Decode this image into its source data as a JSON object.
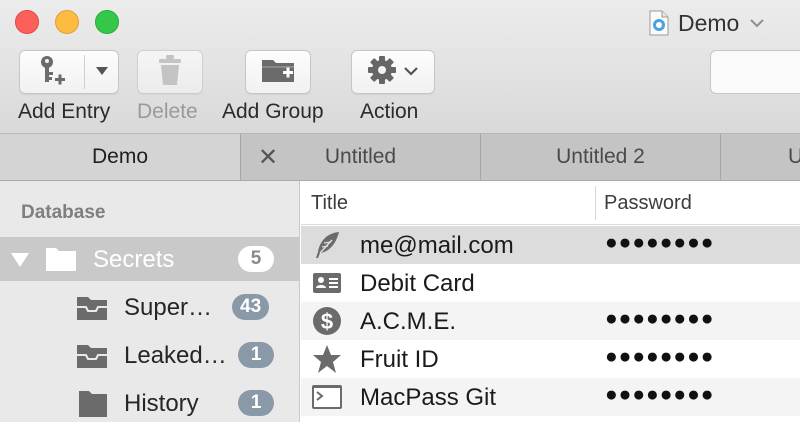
{
  "window": {
    "document_title": "Demo"
  },
  "toolbar": {
    "add_entry": "Add Entry",
    "delete": "Delete",
    "add_group": "Add Group",
    "action": "Action"
  },
  "tabs": [
    {
      "label": "Demo",
      "active": true
    },
    {
      "label": "Untitled",
      "active": false
    },
    {
      "label": "Untitled 2",
      "active": false
    },
    {
      "label": "U",
      "active": false
    }
  ],
  "sidebar": {
    "header": "Database",
    "items": [
      {
        "label": "Secrets",
        "count": "5",
        "selected": true,
        "icon": "folder-icon"
      },
      {
        "label": "Super…",
        "count": "43",
        "selected": false,
        "icon": "inbox-folder-icon"
      },
      {
        "label": "Leaked…",
        "count": "1",
        "selected": false,
        "icon": "inbox-folder-icon"
      },
      {
        "label": "History",
        "count": "1",
        "selected": false,
        "icon": "folder-icon"
      }
    ]
  },
  "table": {
    "columns": {
      "title": "Title",
      "password": "Password"
    },
    "rows": [
      {
        "title": "me@mail.com",
        "password": "●●●●●●●●",
        "icon": "feather-icon",
        "selected": true
      },
      {
        "title": "Debit Card",
        "password": "",
        "icon": "id-card-icon",
        "selected": false
      },
      {
        "title": "A.C.M.E.",
        "password": "●●●●●●●●",
        "icon": "dollar-icon",
        "selected": false
      },
      {
        "title": "Fruit ID",
        "password": "●●●●●●●●",
        "icon": "star-icon",
        "selected": false
      },
      {
        "title": "MacPass Git",
        "password": "●●●●●●●●",
        "icon": "terminal-icon",
        "selected": false
      }
    ]
  },
  "colors": {
    "close": "#fc605b",
    "minimize": "#fdbc40",
    "zoom": "#34c84a",
    "badge": "#8a99a8"
  }
}
